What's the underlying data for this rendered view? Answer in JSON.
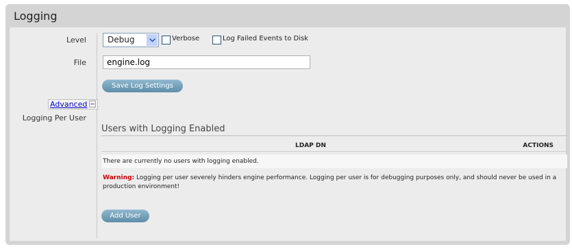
{
  "panel": {
    "title": "Logging"
  },
  "form": {
    "level_label": "Level",
    "level_value": "Debug",
    "verbose_label": "Verbose",
    "log_failed_label": "Log Failed Events to Disk",
    "file_label": "File",
    "file_value": "engine.log",
    "save_label": "Save Log Settings",
    "advanced_label": "Advanced",
    "logging_per_user_label": "Logging Per User"
  },
  "users_section": {
    "title": "Users with Logging Enabled",
    "columns": [
      "LDAP DN",
      "ACTIONS"
    ],
    "empty_message": "There are currently no users with logging enabled.",
    "warning_label": "Warning:",
    "warning_text": "Logging per user severely hinders engine performance. Logging per user is for debugging purposes only, and should never be used in a production environment!",
    "add_user_label": "Add User"
  },
  "icons": {
    "dropdown": "chevron-down-icon",
    "advanced_toggle": "collapse-icon"
  },
  "colors": {
    "button": "#6e9ab4",
    "warning": "#cc0000",
    "link": "#0000cc"
  }
}
